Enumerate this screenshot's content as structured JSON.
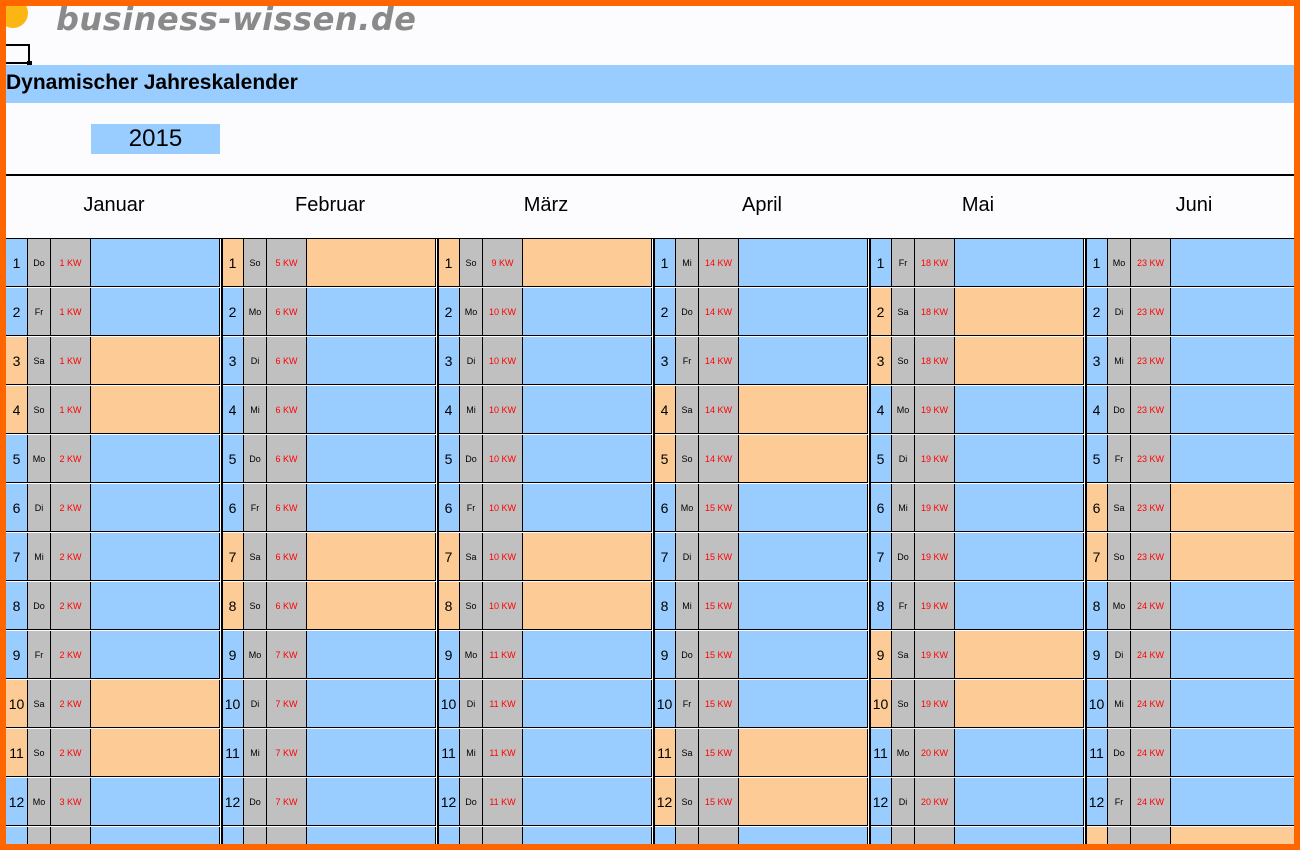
{
  "header": {
    "logo_text": "business-wissen.de",
    "title": "Dynamischer Jahreskalender",
    "year": "2015"
  },
  "colors": {
    "frame": "#ff6600",
    "weekday_fill": "#99ccff",
    "weekend_fill": "#fccb96",
    "label_fill": "#c0c0c0",
    "kw_text": "#ff0000"
  },
  "months": [
    {
      "name": "Januar",
      "days": [
        {
          "num": "1",
          "wd": "Do",
          "kw": "1 KW",
          "weekend": false
        },
        {
          "num": "2",
          "wd": "Fr",
          "kw": "1 KW",
          "weekend": false
        },
        {
          "num": "3",
          "wd": "Sa",
          "kw": "1 KW",
          "weekend": true
        },
        {
          "num": "4",
          "wd": "So",
          "kw": "1 KW",
          "weekend": true
        },
        {
          "num": "5",
          "wd": "Mo",
          "kw": "2 KW",
          "weekend": false
        },
        {
          "num": "6",
          "wd": "Di",
          "kw": "2 KW",
          "weekend": false
        },
        {
          "num": "7",
          "wd": "Mi",
          "kw": "2 KW",
          "weekend": false
        },
        {
          "num": "8",
          "wd": "Do",
          "kw": "2 KW",
          "weekend": false
        },
        {
          "num": "9",
          "wd": "Fr",
          "kw": "2 KW",
          "weekend": false
        },
        {
          "num": "10",
          "wd": "Sa",
          "kw": "2 KW",
          "weekend": true
        },
        {
          "num": "11",
          "wd": "So",
          "kw": "2 KW",
          "weekend": true
        },
        {
          "num": "12",
          "wd": "Mo",
          "kw": "3 KW",
          "weekend": false
        },
        {
          "num": "",
          "wd": "",
          "kw": "",
          "weekend": false
        }
      ]
    },
    {
      "name": "Februar",
      "days": [
        {
          "num": "1",
          "wd": "So",
          "kw": "5 KW",
          "weekend": true
        },
        {
          "num": "2",
          "wd": "Mo",
          "kw": "6 KW",
          "weekend": false
        },
        {
          "num": "3",
          "wd": "Di",
          "kw": "6 KW",
          "weekend": false
        },
        {
          "num": "4",
          "wd": "Mi",
          "kw": "6 KW",
          "weekend": false
        },
        {
          "num": "5",
          "wd": "Do",
          "kw": "6 KW",
          "weekend": false
        },
        {
          "num": "6",
          "wd": "Fr",
          "kw": "6 KW",
          "weekend": false
        },
        {
          "num": "7",
          "wd": "Sa",
          "kw": "6 KW",
          "weekend": true
        },
        {
          "num": "8",
          "wd": "So",
          "kw": "6 KW",
          "weekend": true
        },
        {
          "num": "9",
          "wd": "Mo",
          "kw": "7 KW",
          "weekend": false
        },
        {
          "num": "10",
          "wd": "Di",
          "kw": "7 KW",
          "weekend": false
        },
        {
          "num": "11",
          "wd": "Mi",
          "kw": "7 KW",
          "weekend": false
        },
        {
          "num": "12",
          "wd": "Do",
          "kw": "7 KW",
          "weekend": false
        },
        {
          "num": "",
          "wd": "",
          "kw": "",
          "weekend": false
        }
      ]
    },
    {
      "name": "März",
      "days": [
        {
          "num": "1",
          "wd": "So",
          "kw": "9 KW",
          "weekend": true
        },
        {
          "num": "2",
          "wd": "Mo",
          "kw": "10 KW",
          "weekend": false
        },
        {
          "num": "3",
          "wd": "Di",
          "kw": "10 KW",
          "weekend": false
        },
        {
          "num": "4",
          "wd": "Mi",
          "kw": "10 KW",
          "weekend": false
        },
        {
          "num": "5",
          "wd": "Do",
          "kw": "10 KW",
          "weekend": false
        },
        {
          "num": "6",
          "wd": "Fr",
          "kw": "10 KW",
          "weekend": false
        },
        {
          "num": "7",
          "wd": "Sa",
          "kw": "10 KW",
          "weekend": true
        },
        {
          "num": "8",
          "wd": "So",
          "kw": "10 KW",
          "weekend": true
        },
        {
          "num": "9",
          "wd": "Mo",
          "kw": "11 KW",
          "weekend": false
        },
        {
          "num": "10",
          "wd": "Di",
          "kw": "11 KW",
          "weekend": false
        },
        {
          "num": "11",
          "wd": "Mi",
          "kw": "11 KW",
          "weekend": false
        },
        {
          "num": "12",
          "wd": "Do",
          "kw": "11 KW",
          "weekend": false
        },
        {
          "num": "",
          "wd": "",
          "kw": "",
          "weekend": false
        }
      ]
    },
    {
      "name": "April",
      "days": [
        {
          "num": "1",
          "wd": "Mi",
          "kw": "14 KW",
          "weekend": false
        },
        {
          "num": "2",
          "wd": "Do",
          "kw": "14 KW",
          "weekend": false
        },
        {
          "num": "3",
          "wd": "Fr",
          "kw": "14 KW",
          "weekend": false
        },
        {
          "num": "4",
          "wd": "Sa",
          "kw": "14 KW",
          "weekend": true
        },
        {
          "num": "5",
          "wd": "So",
          "kw": "14 KW",
          "weekend": true
        },
        {
          "num": "6",
          "wd": "Mo",
          "kw": "15 KW",
          "weekend": false
        },
        {
          "num": "7",
          "wd": "Di",
          "kw": "15 KW",
          "weekend": false
        },
        {
          "num": "8",
          "wd": "Mi",
          "kw": "15 KW",
          "weekend": false
        },
        {
          "num": "9",
          "wd": "Do",
          "kw": "15 KW",
          "weekend": false
        },
        {
          "num": "10",
          "wd": "Fr",
          "kw": "15 KW",
          "weekend": false
        },
        {
          "num": "11",
          "wd": "Sa",
          "kw": "15 KW",
          "weekend": true
        },
        {
          "num": "12",
          "wd": "So",
          "kw": "15 KW",
          "weekend": true
        },
        {
          "num": "",
          "wd": "",
          "kw": "",
          "weekend": false
        }
      ]
    },
    {
      "name": "Mai",
      "days": [
        {
          "num": "1",
          "wd": "Fr",
          "kw": "18 KW",
          "weekend": false
        },
        {
          "num": "2",
          "wd": "Sa",
          "kw": "18 KW",
          "weekend": true
        },
        {
          "num": "3",
          "wd": "So",
          "kw": "18 KW",
          "weekend": true
        },
        {
          "num": "4",
          "wd": "Mo",
          "kw": "19 KW",
          "weekend": false
        },
        {
          "num": "5",
          "wd": "Di",
          "kw": "19 KW",
          "weekend": false
        },
        {
          "num": "6",
          "wd": "Mi",
          "kw": "19 KW",
          "weekend": false
        },
        {
          "num": "7",
          "wd": "Do",
          "kw": "19 KW",
          "weekend": false
        },
        {
          "num": "8",
          "wd": "Fr",
          "kw": "19 KW",
          "weekend": false
        },
        {
          "num": "9",
          "wd": "Sa",
          "kw": "19 KW",
          "weekend": true
        },
        {
          "num": "10",
          "wd": "So",
          "kw": "19 KW",
          "weekend": true
        },
        {
          "num": "11",
          "wd": "Mo",
          "kw": "20 KW",
          "weekend": false
        },
        {
          "num": "12",
          "wd": "Di",
          "kw": "20 KW",
          "weekend": false
        },
        {
          "num": "",
          "wd": "",
          "kw": "",
          "weekend": false
        }
      ]
    },
    {
      "name": "Juni",
      "days": [
        {
          "num": "1",
          "wd": "Mo",
          "kw": "23 KW",
          "weekend": false
        },
        {
          "num": "2",
          "wd": "Di",
          "kw": "23 KW",
          "weekend": false
        },
        {
          "num": "3",
          "wd": "Mi",
          "kw": "23 KW",
          "weekend": false
        },
        {
          "num": "4",
          "wd": "Do",
          "kw": "23 KW",
          "weekend": false
        },
        {
          "num": "5",
          "wd": "Fr",
          "kw": "23 KW",
          "weekend": false
        },
        {
          "num": "6",
          "wd": "Sa",
          "kw": "23 KW",
          "weekend": true
        },
        {
          "num": "7",
          "wd": "So",
          "kw": "23 KW",
          "weekend": true
        },
        {
          "num": "8",
          "wd": "Mo",
          "kw": "24 KW",
          "weekend": false
        },
        {
          "num": "9",
          "wd": "Di",
          "kw": "24 KW",
          "weekend": false
        },
        {
          "num": "10",
          "wd": "Mi",
          "kw": "24 KW",
          "weekend": false
        },
        {
          "num": "11",
          "wd": "Do",
          "kw": "24 KW",
          "weekend": false
        },
        {
          "num": "12",
          "wd": "Fr",
          "kw": "24 KW",
          "weekend": false
        },
        {
          "num": "",
          "wd": "",
          "kw": "",
          "weekend": true
        }
      ]
    }
  ]
}
